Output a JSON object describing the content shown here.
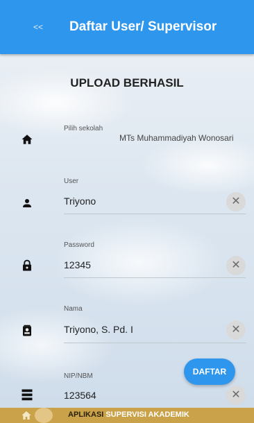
{
  "appbar": {
    "back_label": "<<",
    "title": "Daftar User/ Supervisor"
  },
  "heading": "UPLOAD BERHASIL",
  "fields": {
    "sekolah": {
      "label": "Pilih sekolah",
      "value": "MTs Muhammadiyah Wonosari",
      "icon": "home-icon"
    },
    "user": {
      "label": "User",
      "value": "Triyono",
      "icon": "person-icon"
    },
    "password": {
      "label": "Password",
      "value": "12345",
      "icon": "lock-icon"
    },
    "nama": {
      "label": "Nama",
      "value": "Triyono, S. Pd. I",
      "icon": "contact-card-icon"
    },
    "nip": {
      "label": "NIP/NBM",
      "value": "123564",
      "icon": "list-icon"
    }
  },
  "clear_symbol": "✕",
  "fab_label": "DAFTAR",
  "footer": {
    "part1": "APLIKASI",
    "part2": "SUPERVISI AKADEMIK"
  },
  "colors": {
    "primary": "#2f96ee",
    "footer": "#c9a24a"
  }
}
